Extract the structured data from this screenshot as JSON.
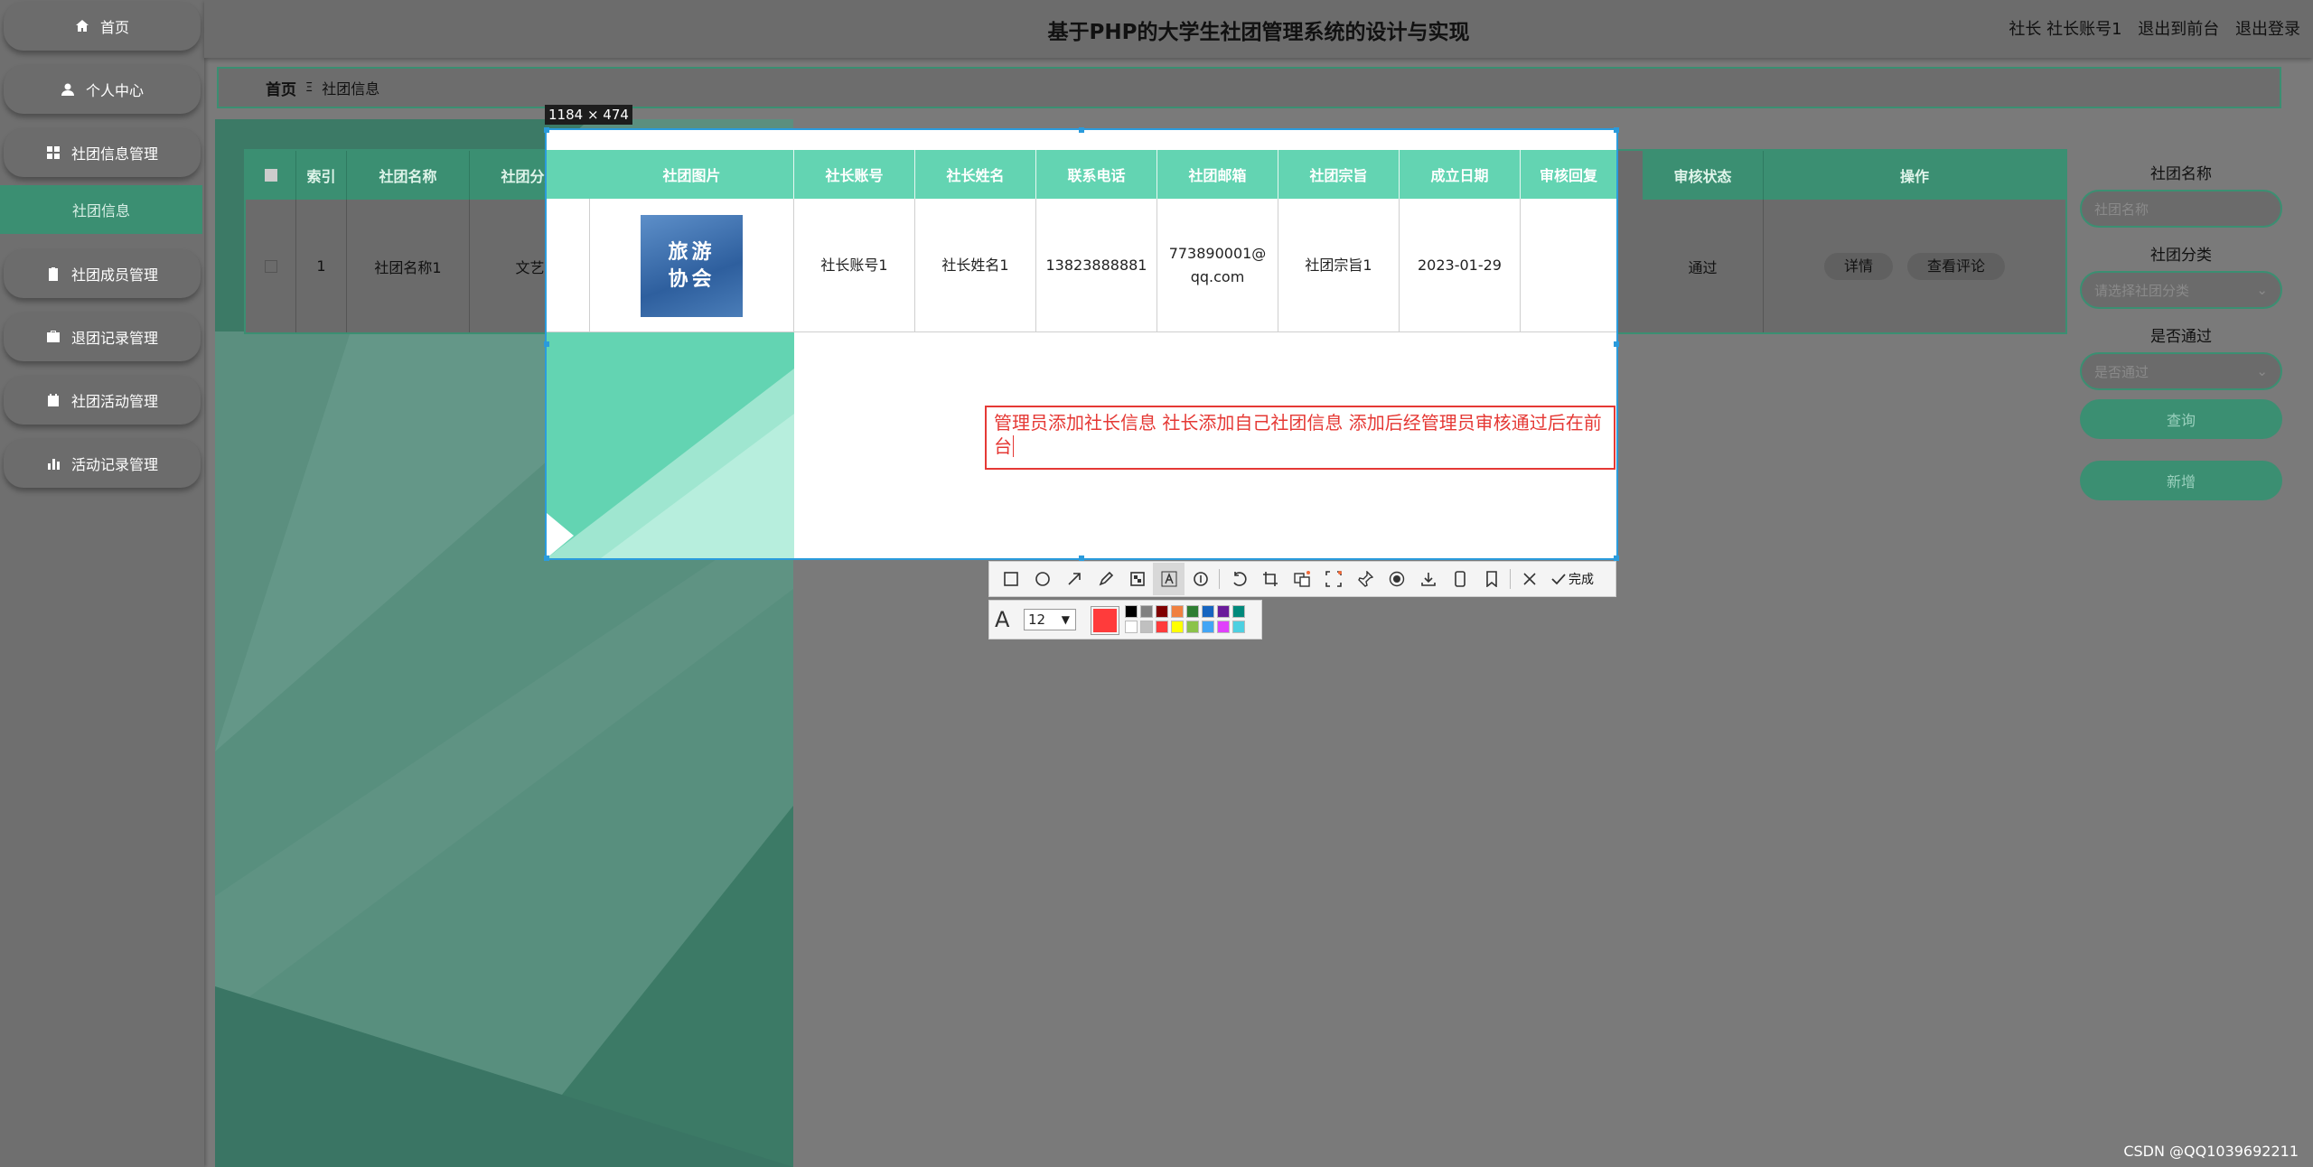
{
  "nav": [
    {
      "label": "首页",
      "icon": "home-icon"
    },
    {
      "label": "个人中心",
      "icon": "user-icon"
    },
    {
      "label": "社团信息管理",
      "icon": "grid-icon"
    },
    {
      "label": "社团信息",
      "icon": ""
    },
    {
      "label": "社团成员管理",
      "icon": "clipboard-icon"
    },
    {
      "label": "退团记录管理",
      "icon": "briefcase-icon"
    },
    {
      "label": "社团活动管理",
      "icon": "calendar-icon"
    },
    {
      "label": "活动记录管理",
      "icon": "bar-chart-icon"
    }
  ],
  "header": {
    "title": "基于PHP的大学生社团管理系统的设计与实现",
    "user": "社长 社长账号1",
    "to_front": "退出到前台",
    "logout": "退出登录"
  },
  "breadcrumb": {
    "home": "首页",
    "sep": "Ξ",
    "current": "社团信息"
  },
  "table": {
    "headers": [
      "索引",
      "社团名称",
      "社团分类",
      "社团图片",
      "社长账号",
      "社长姓名",
      "联系电话",
      "社团邮箱",
      "社团宗旨",
      "成立日期",
      "审核回复",
      "审核状态",
      "操作"
    ],
    "row": {
      "index": "1",
      "name": "社团名称1",
      "category": "文艺",
      "account": "社长账号1",
      "leader": "社长姓名1",
      "phone": "13823888881",
      "email": "773890001@qq.com",
      "purpose": "社团宗旨1",
      "date": "2023-01-29",
      "reply": "",
      "status": "通过"
    },
    "image_text": "旅游协会",
    "actions": {
      "detail": "详情",
      "comments": "查看评论"
    }
  },
  "filter": {
    "name_label": "社团名称",
    "name_placeholder": "社团名称",
    "category_label": "社团分类",
    "category_placeholder": "请选择社团分类",
    "approved_label": "是否通过",
    "approved_placeholder": "是否通过",
    "query": "查询",
    "add": "新增"
  },
  "screenshot_tool": {
    "size": "1184 × 474",
    "annotation": "管理员添加社长信息 社长添加自己社团信息 添加后经管理员审核通过后在前台",
    "font_size": "12",
    "done": "完成",
    "current_color": "#ff3b3b",
    "palette": [
      "#000000",
      "#808080",
      "#800000",
      "#f08040",
      "#2e7d32",
      "#1565c0",
      "#6a1b9a",
      "#00897b",
      "#ffffff",
      "#c0c0c0",
      "#ff3b3b",
      "#ffff00",
      "#8bc34a",
      "#42a5f5",
      "#e040fb",
      "#4dd0e1"
    ]
  },
  "watermark": "CSDN @QQ1039692211"
}
